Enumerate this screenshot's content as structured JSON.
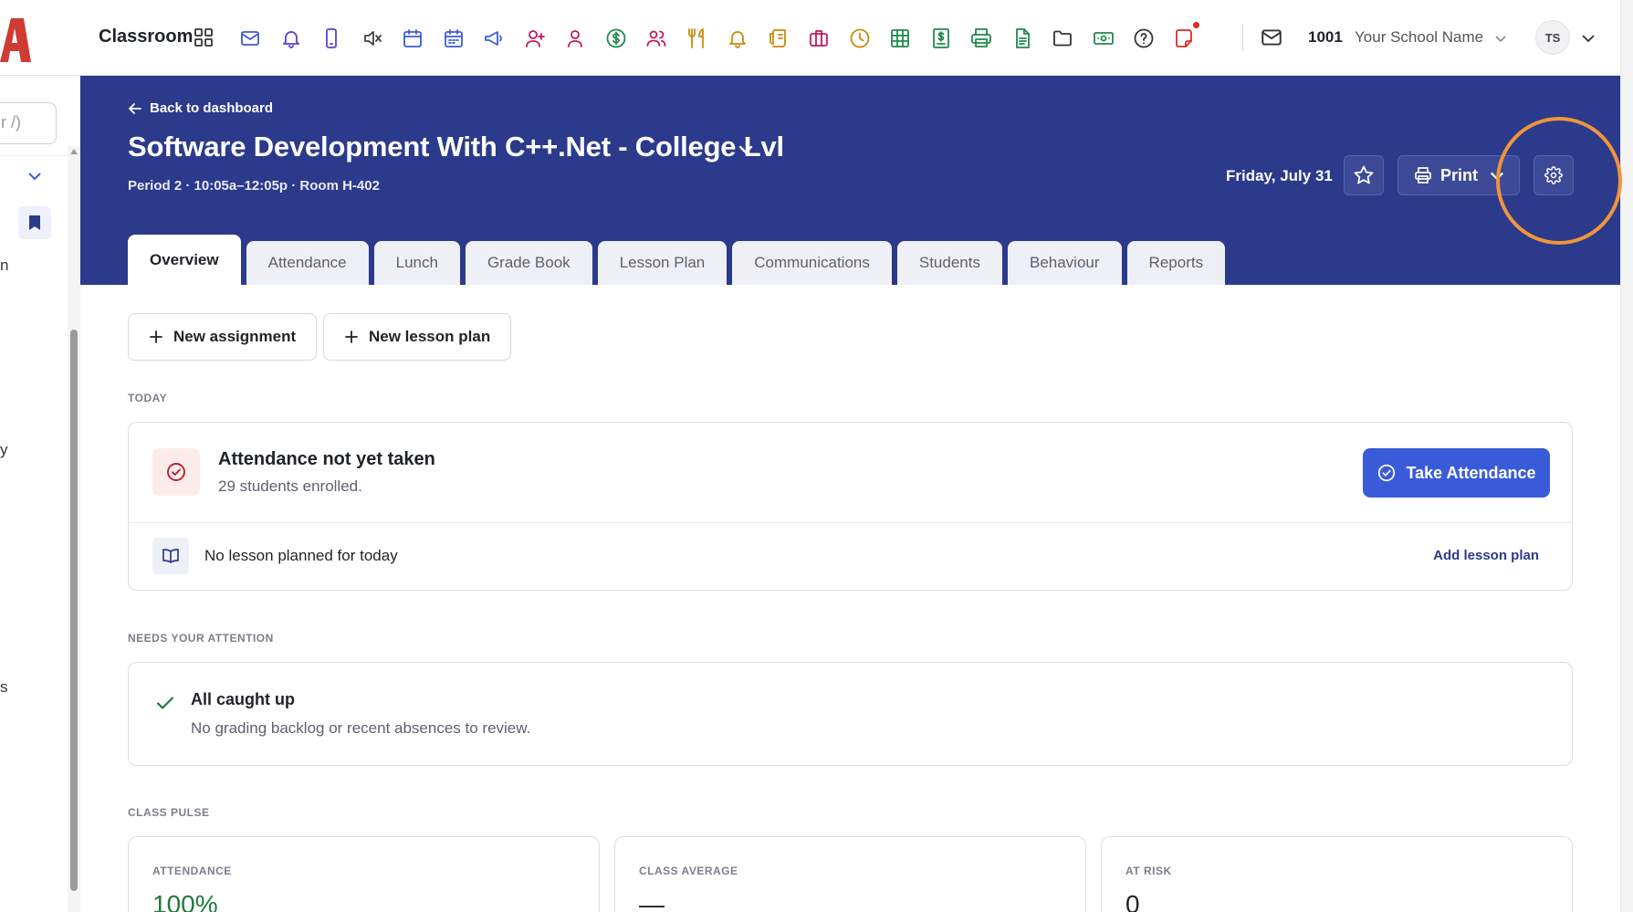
{
  "topbar": {
    "brand": "Classroom",
    "school_number": "1001",
    "school_name": "Your School Name",
    "user_initials": "TS",
    "icons": [
      {
        "name": "mail-icon",
        "color": "#3b5bd6"
      },
      {
        "name": "bell-icon",
        "color": "#5b3fd6"
      },
      {
        "name": "mobile-icon",
        "color": "#5b3fd6"
      },
      {
        "name": "mute-icon",
        "color": "#444444"
      },
      {
        "name": "calendar-icon",
        "color": "#3b5bd6"
      },
      {
        "name": "calendar-grid-icon",
        "color": "#3b5bd6"
      },
      {
        "name": "megaphone-icon",
        "color": "#3b5bd6"
      },
      {
        "name": "add-user-icon",
        "color": "#c2185b"
      },
      {
        "name": "user-icon",
        "color": "#c2185b"
      },
      {
        "name": "dollar-icon",
        "color": "#1e8a4c"
      },
      {
        "name": "users-icon",
        "color": "#c2185b"
      },
      {
        "name": "utensils-icon",
        "color": "#c98a0b"
      },
      {
        "name": "alert-bell-icon",
        "color": "#c98a0b"
      },
      {
        "name": "scroll-icon",
        "color": "#c98a0b"
      },
      {
        "name": "briefcase-icon",
        "color": "#c2185b"
      },
      {
        "name": "clock-icon",
        "color": "#c98a0b"
      },
      {
        "name": "table-icon",
        "color": "#1e8a4c"
      },
      {
        "name": "invoice-icon",
        "color": "#1e8a4c"
      },
      {
        "name": "printer-icon",
        "color": "#1e8a4c"
      },
      {
        "name": "document-icon",
        "color": "#1e8a4c"
      },
      {
        "name": "folder-icon",
        "color": "#333333"
      },
      {
        "name": "cash-icon",
        "color": "#1e8a4c"
      },
      {
        "name": "help-icon",
        "color": "#333333"
      },
      {
        "name": "note-icon",
        "color": "#d92d20"
      }
    ]
  },
  "sidebar": {
    "search_placeholder": "r /)",
    "fragments": [
      "n",
      "y",
      "s"
    ]
  },
  "course": {
    "back_label": "Back to dashboard",
    "title": "Software Development With C++.Net - College Lvl",
    "meta": "Period 2 · 10:05a–12:05p · Room H-402",
    "date": "Friday, July 31",
    "print_label": "Print"
  },
  "tabs": [
    {
      "label": "Overview",
      "active": true
    },
    {
      "label": "Attendance",
      "active": false
    },
    {
      "label": "Lunch",
      "active": false
    },
    {
      "label": "Grade Book",
      "active": false
    },
    {
      "label": "Lesson Plan",
      "active": false
    },
    {
      "label": "Communications",
      "active": false
    },
    {
      "label": "Students",
      "active": false
    },
    {
      "label": "Behaviour",
      "active": false
    },
    {
      "label": "Reports",
      "active": false
    }
  ],
  "actions": {
    "new_assignment": "New assignment",
    "new_lesson_plan": "New lesson plan"
  },
  "today": {
    "section_label": "TODAY",
    "attendance_title": "Attendance not yet taken",
    "attendance_sub": "29 students enrolled.",
    "take_attendance": "Take Attendance",
    "lesson_text": "No lesson planned for today",
    "add_lesson": "Add lesson plan"
  },
  "attention": {
    "section_label": "NEEDS YOUR ATTENTION",
    "title": "All caught up",
    "sub": "No grading backlog or recent absences to review."
  },
  "pulse": {
    "section_label": "CLASS PULSE",
    "cards": [
      {
        "label": "ATTENDANCE",
        "value": "100%",
        "color": "#1e7a3c"
      },
      {
        "label": "CLASS AVERAGE",
        "value": "—",
        "color": "#1f2328"
      },
      {
        "label": "AT RISK",
        "value": "0",
        "color": "#1f2328"
      }
    ]
  },
  "colors": {
    "header_blue": "#2c3a8c",
    "primary": "#3a5bd9",
    "highlight": "#f0953b"
  }
}
